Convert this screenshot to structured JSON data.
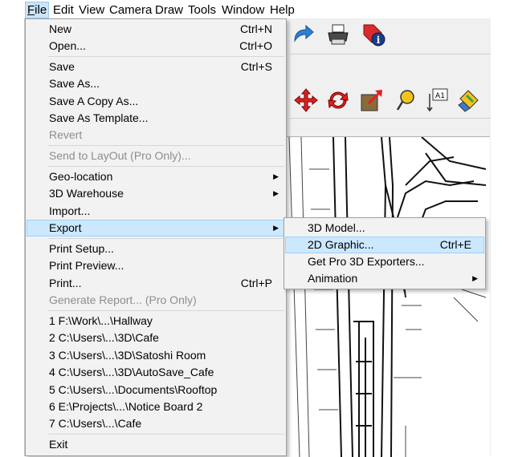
{
  "menubar": {
    "items": [
      {
        "label": "File",
        "underline": "F"
      },
      {
        "label": "Edit"
      },
      {
        "label": "View"
      },
      {
        "label": "Camera"
      },
      {
        "label": "Draw"
      },
      {
        "label": "Tools"
      },
      {
        "label": "Window"
      },
      {
        "label": "Help"
      }
    ]
  },
  "file_menu": {
    "new": {
      "label": "New",
      "shortcut": "Ctrl+N"
    },
    "open": {
      "label": "Open...",
      "shortcut": "Ctrl+O"
    },
    "save": {
      "label": "Save",
      "shortcut": "Ctrl+S"
    },
    "save_as": {
      "label": "Save As..."
    },
    "save_copy_as": {
      "label": "Save A Copy As..."
    },
    "save_as_template": {
      "label": "Save As Template..."
    },
    "revert": {
      "label": "Revert"
    },
    "send_to_layout": {
      "label": "Send to LayOut (Pro Only)..."
    },
    "geo_location": {
      "label": "Geo-location"
    },
    "warehouse": {
      "label": "3D Warehouse"
    },
    "import": {
      "label": "Import..."
    },
    "export": {
      "label": "Export"
    },
    "print_setup": {
      "label": "Print Setup..."
    },
    "print_preview": {
      "label": "Print Preview..."
    },
    "print": {
      "label": "Print...",
      "shortcut": "Ctrl+P"
    },
    "generate_report": {
      "label": "Generate Report... (Pro Only)"
    },
    "recent": [
      "1 F:\\Work\\...\\Hallway",
      "2 C:\\Users\\...\\3D\\Cafe",
      "3 C:\\Users\\...\\3D\\Satoshi Room",
      "4 C:\\Users\\...\\3D\\AutoSave_Cafe",
      "5 C:\\Users\\...\\Documents\\Rooftop",
      "6 E:\\Projects\\...\\Notice Board 2",
      "7 C:\\Users\\...\\Cafe"
    ],
    "exit": {
      "label": "Exit"
    }
  },
  "export_menu": {
    "model": {
      "label": "3D Model..."
    },
    "graphic": {
      "label": "2D Graphic...",
      "shortcut": "Ctrl+E"
    },
    "pro_exporters": {
      "label": "Get Pro 3D Exporters..."
    },
    "animation": {
      "label": "Animation"
    }
  },
  "icons": {
    "submenu_arrow": "▶"
  }
}
